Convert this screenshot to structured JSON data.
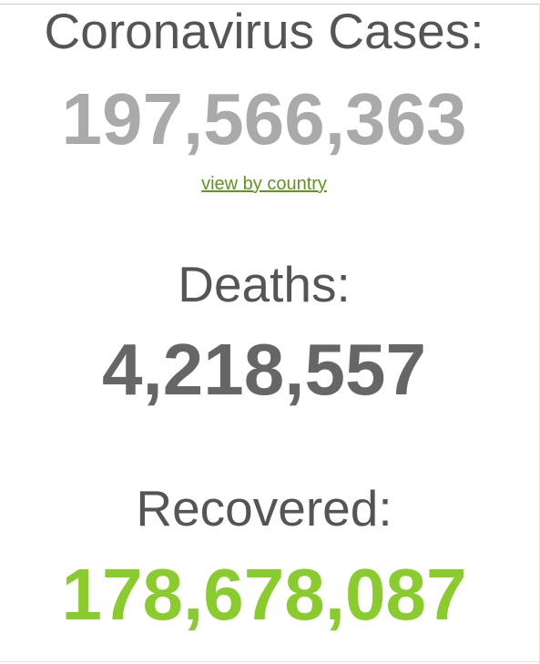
{
  "counters": {
    "cases": {
      "label": "Coronavirus Cases:",
      "value": "197,566,363",
      "link_label": "view by country",
      "color": "#aaaaaa"
    },
    "deaths": {
      "label": "Deaths:",
      "value": "4,218,557",
      "color": "#666666"
    },
    "recovered": {
      "label": "Recovered:",
      "value": "178,678,087",
      "color": "#8acb2e"
    }
  },
  "colors": {
    "label_text": "#555555",
    "link": "#609521",
    "background": "#ffffff"
  }
}
